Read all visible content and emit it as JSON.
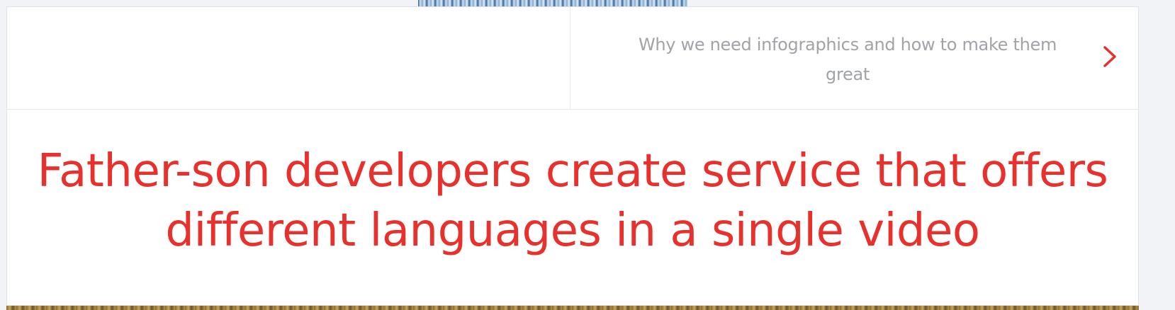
{
  "navigation": {
    "next_article_title": "Why we need infographics and how to make them great"
  },
  "article": {
    "title": "Father-son developers create service that offers different languages in a single video"
  },
  "colors": {
    "accent": "#e8312c",
    "nav_text": "#a0a3a8",
    "border": "#e6e9ee"
  },
  "icons": {
    "next": "chevron-right-icon"
  }
}
